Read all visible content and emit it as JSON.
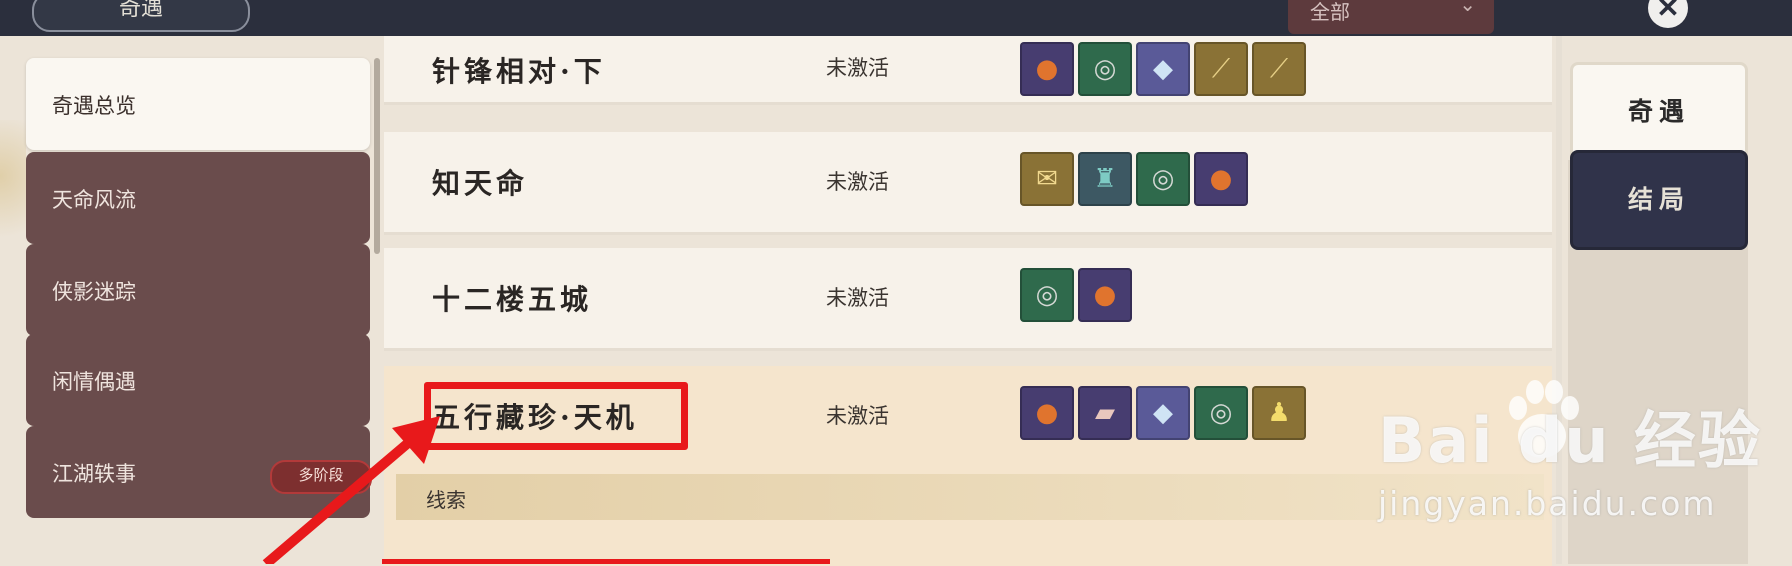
{
  "header": {
    "title": "奇遇",
    "filter_value": "全部",
    "close_glyph": "✕"
  },
  "sidebar": {
    "items": [
      {
        "label": "奇遇总览",
        "active": true
      },
      {
        "label": "天命风流",
        "active": false
      },
      {
        "label": "侠影迷踪",
        "active": false
      },
      {
        "label": "闲情偶遇",
        "active": false
      },
      {
        "label": "江湖轶事",
        "active": false,
        "badge": "多阶段"
      }
    ]
  },
  "encounters": [
    {
      "name": "针锋相对·下",
      "status": "未激活",
      "rewards": [
        {
          "icon": "gift-box-icon",
          "rarity": "purple"
        },
        {
          "icon": "coin-disc-icon",
          "rarity": "green"
        },
        {
          "icon": "crystal-shard-icon",
          "rarity": "blue"
        },
        {
          "icon": "sword-icon",
          "rarity": "gold"
        },
        {
          "icon": "sword-icon",
          "rarity": "gold"
        }
      ]
    },
    {
      "name": "知天命",
      "status": "未激活",
      "rewards": [
        {
          "icon": "scroll-icon",
          "rarity": "gold"
        },
        {
          "icon": "armor-icon",
          "rarity": "teal"
        },
        {
          "icon": "coin-disc-icon",
          "rarity": "green"
        },
        {
          "icon": "gift-box-icon",
          "rarity": "purple"
        }
      ]
    },
    {
      "name": "十二楼五城",
      "status": "未激活",
      "rewards": [
        {
          "icon": "coin-disc-icon",
          "rarity": "green"
        },
        {
          "icon": "gift-box-icon",
          "rarity": "purple"
        }
      ]
    },
    {
      "name": "五行藏珍·天机",
      "status": "未激活",
      "expanded": true,
      "clue_label": "线索",
      "rewards": [
        {
          "icon": "gift-box-icon",
          "rarity": "purple"
        },
        {
          "icon": "cloth-icon",
          "rarity": "purple"
        },
        {
          "icon": "crystal-shard-icon",
          "rarity": "blue"
        },
        {
          "icon": "coin-disc-icon",
          "rarity": "green"
        },
        {
          "icon": "figurine-icon",
          "rarity": "gold"
        }
      ]
    }
  ],
  "tabs": [
    {
      "label": "奇遇",
      "active": true
    },
    {
      "label": "结局",
      "active": false
    }
  ],
  "watermark": {
    "logo": "Bai du 经验",
    "url": "jingyan.baidu.com"
  },
  "annotation": {
    "color": "#e8191b"
  },
  "colors": {
    "topbar": "#2b2f3d",
    "sidebar_item": "#6a4c4c",
    "active_tab_bg": "#faf7f1",
    "inactive_tab_bg": "#30334a",
    "expanded_row": "#f5e5cd"
  }
}
